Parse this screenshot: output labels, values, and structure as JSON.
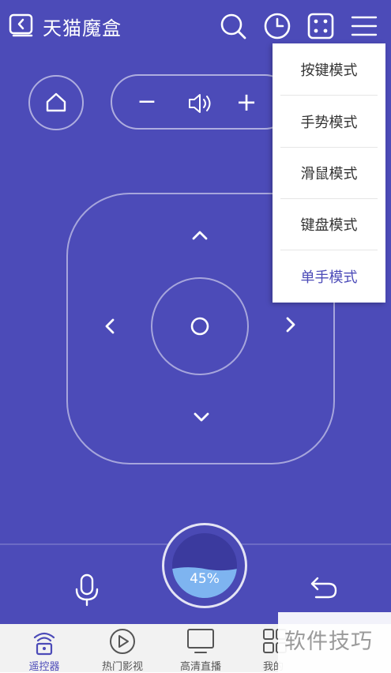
{
  "app": {
    "title": "天猫魔盒",
    "accent": "#4c4bb8"
  },
  "topbar_icons": [
    "search-icon",
    "clock-icon",
    "dice-icon",
    "menu-icon"
  ],
  "mode_menu": {
    "items": [
      {
        "label": "按键模式",
        "active": false
      },
      {
        "label": "手势模式",
        "active": false
      },
      {
        "label": "滑鼠模式",
        "active": false
      },
      {
        "label": "键盘模式",
        "active": false
      },
      {
        "label": "单手模式",
        "active": true
      }
    ]
  },
  "controls": {
    "volume_minus": "−",
    "volume_plus": "+"
  },
  "battery": {
    "percent_label": "45%",
    "level": 0.45
  },
  "tabs": [
    {
      "label": "遥控器",
      "icon": "wifi-remote-icon",
      "active": true
    },
    {
      "label": "热门影视",
      "icon": "play-icon",
      "active": false
    },
    {
      "label": "高清直播",
      "icon": "tv-icon",
      "active": false
    },
    {
      "label": "我的",
      "icon": "grid-icon",
      "active": false
    }
  ],
  "watermark": "软件技巧"
}
